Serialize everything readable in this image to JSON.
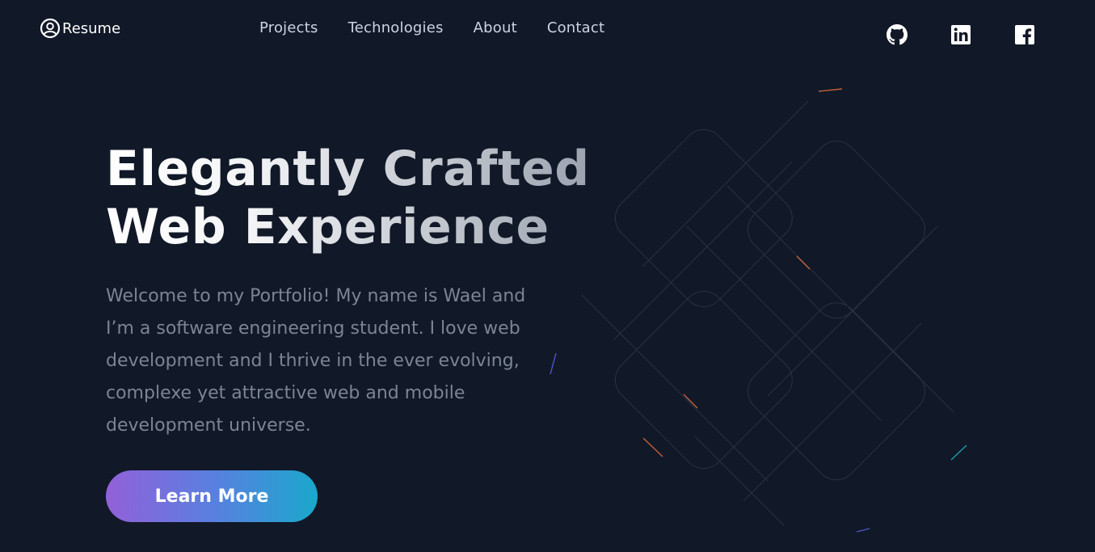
{
  "header": {
    "resume_label": "Resume",
    "nav": [
      {
        "label": "Projects"
      },
      {
        "label": "Technologies"
      },
      {
        "label": "About"
      },
      {
        "label": "Contact"
      }
    ],
    "socials": [
      "github-icon",
      "linkedin-icon",
      "facebook-icon"
    ]
  },
  "hero": {
    "title_line1": "Elegantly Crafted",
    "title_line2": "Web Experience",
    "text": "Welcome to my Portfolio! My name is Wael and I’m a software engineering student. I love web development and I thrive in the ever evolving, complexe yet attractive web and mobile development universe.",
    "cta_label": "Learn More"
  },
  "colors": {
    "background": "#111827",
    "cta_start": "#9261d9",
    "cta_end": "#1aa8cc"
  }
}
